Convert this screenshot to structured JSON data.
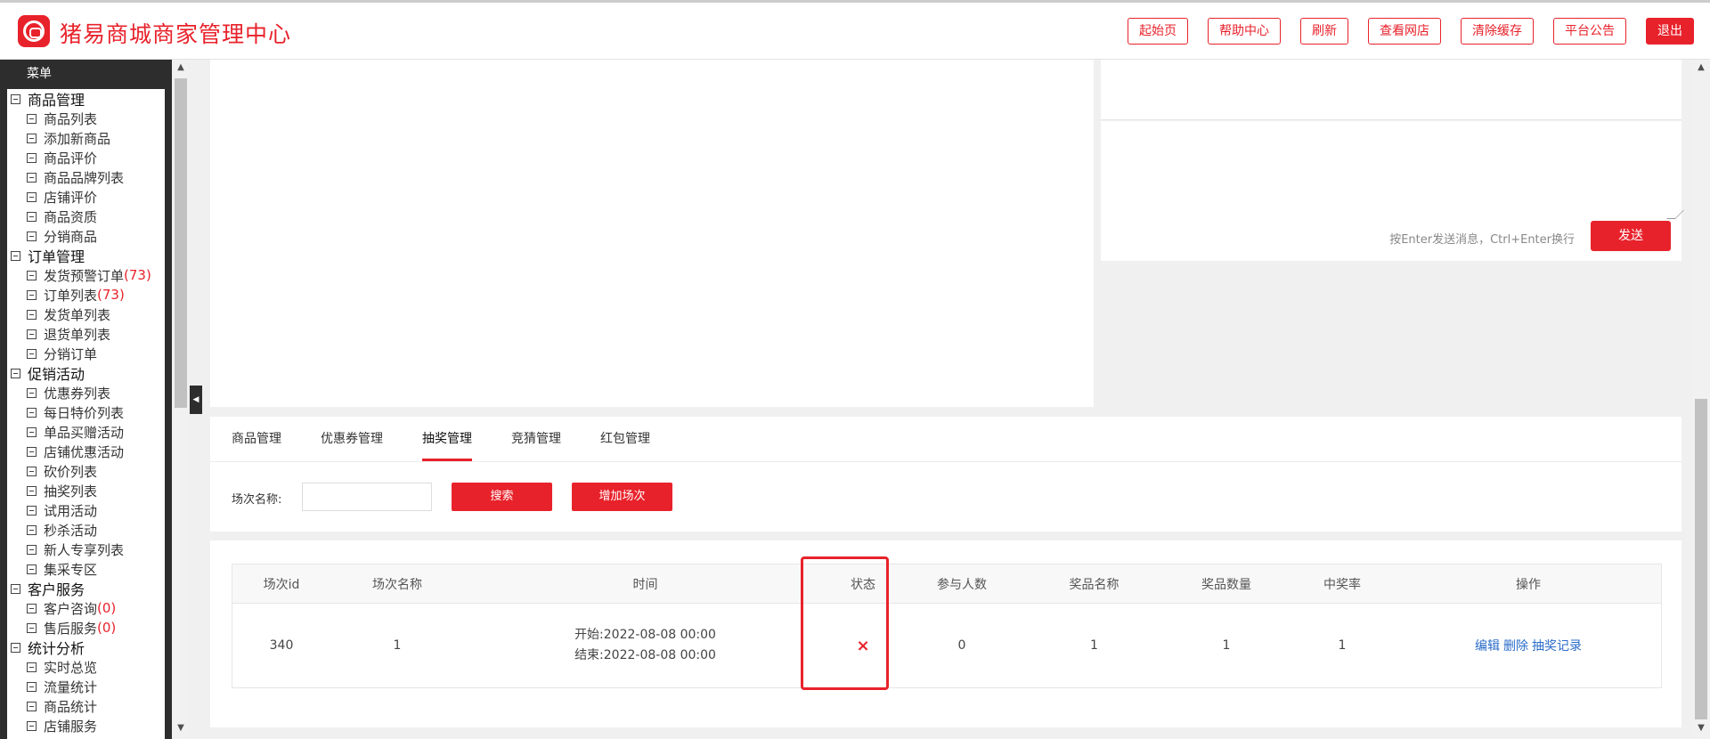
{
  "header": {
    "title": "猪易商城商家管理中心",
    "links": [
      "起始页",
      "帮助中心",
      "刷新",
      "查看网店",
      "清除缓存",
      "平台公告"
    ],
    "exit_label": "退出"
  },
  "sidebar": {
    "heading": "菜单",
    "groups": [
      {
        "label": "商品管理",
        "items": [
          {
            "label": "商品列表",
            "count": ""
          },
          {
            "label": "添加新商品",
            "count": ""
          },
          {
            "label": "商品评价",
            "count": ""
          },
          {
            "label": "商品品牌列表",
            "count": ""
          },
          {
            "label": "店铺评价",
            "count": ""
          },
          {
            "label": "商品资质",
            "count": ""
          },
          {
            "label": "分销商品",
            "count": ""
          }
        ]
      },
      {
        "label": "订单管理",
        "items": [
          {
            "label": "发货预警订单",
            "count": "(73)"
          },
          {
            "label": "订单列表",
            "count": "(73)"
          },
          {
            "label": "发货单列表",
            "count": ""
          },
          {
            "label": "退货单列表",
            "count": ""
          },
          {
            "label": "分销订单",
            "count": ""
          }
        ]
      },
      {
        "label": "促销活动",
        "items": [
          {
            "label": "优惠券列表",
            "count": ""
          },
          {
            "label": "每日特价列表",
            "count": ""
          },
          {
            "label": "单品买赠活动",
            "count": ""
          },
          {
            "label": "店铺优惠活动",
            "count": ""
          },
          {
            "label": "砍价列表",
            "count": ""
          },
          {
            "label": "抽奖列表",
            "count": ""
          },
          {
            "label": "试用活动",
            "count": ""
          },
          {
            "label": "秒杀活动",
            "count": ""
          },
          {
            "label": "新人专享列表",
            "count": ""
          },
          {
            "label": "集采专区",
            "count": ""
          }
        ]
      },
      {
        "label": "客户服务",
        "items": [
          {
            "label": "客户咨询",
            "count": "(0)"
          },
          {
            "label": "售后服务",
            "count": "(0)"
          }
        ]
      },
      {
        "label": "统计分析",
        "items": [
          {
            "label": "实时总览",
            "count": ""
          },
          {
            "label": "流量统计",
            "count": ""
          },
          {
            "label": "商品统计",
            "count": ""
          },
          {
            "label": "店铺服务",
            "count": ""
          }
        ]
      }
    ]
  },
  "chat": {
    "hint": "按Enter发送消息，Ctrl+Enter换行",
    "send_label": "发送"
  },
  "tabs": {
    "items": [
      "商品管理",
      "优惠券管理",
      "抽奖管理",
      "竞猜管理",
      "红包管理"
    ],
    "active_index": 2
  },
  "search": {
    "label": "场次名称:",
    "value": "",
    "search_button": "搜索",
    "add_button": "增加场次"
  },
  "table": {
    "headers": [
      "场次id",
      "场次名称",
      "时间",
      "状态",
      "参与人数",
      "奖品名称",
      "奖品数量",
      "中奖率",
      "操作"
    ],
    "rows": [
      {
        "id": "340",
        "name": "1",
        "start": "开始:2022-08-08 00:00",
        "end": "结束:2022-08-08 00:00",
        "status": "×",
        "participants": "0",
        "prize_name": "1",
        "prize_count": "1",
        "win_rate": "1",
        "actions": [
          "编辑",
          "删除",
          "抽奖记录"
        ]
      }
    ]
  },
  "colors": {
    "brand": "#e8222b",
    "link": "#2b6cc9",
    "sidebar_bg": "#2d2d2d"
  }
}
